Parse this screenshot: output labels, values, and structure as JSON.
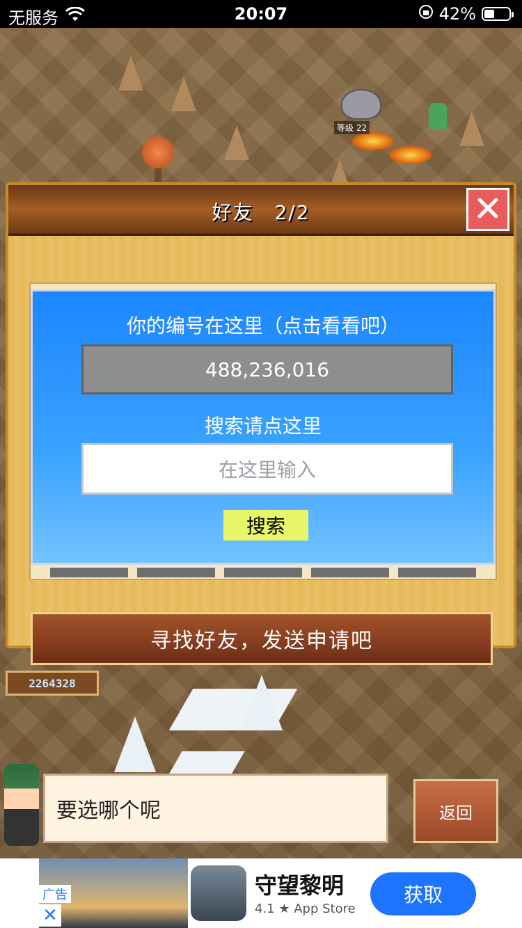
{
  "status_bar": {
    "carrier": "无服务",
    "time": "20:07",
    "battery": "42%",
    "battery_level": 0.42
  },
  "game": {
    "monster_level_label": "等级 22",
    "score": "2264328"
  },
  "friend_panel": {
    "title": "好友　2/2",
    "close_label": "✕",
    "id_label": "你的编号在这里（点击看看吧）",
    "id_value": "488,236,016",
    "search_label": "搜索请点这里",
    "search_placeholder": "在这里输入",
    "search_button": "搜索",
    "find_button": "寻找好友，发送申请吧"
  },
  "dialog": {
    "message": "要选哪个呢",
    "back_button": "返回"
  },
  "ad": {
    "tag": "广告",
    "close": "✕",
    "app_name": "守望黎明",
    "rating": "4.1 ★ App Store",
    "get_button": "获取"
  },
  "colors": {
    "accent_blue": "#1d74ff",
    "panel_blue": "#2a8fff",
    "search_button_bg": "#e8f76a",
    "close_button_bg": "#e85c5c"
  }
}
